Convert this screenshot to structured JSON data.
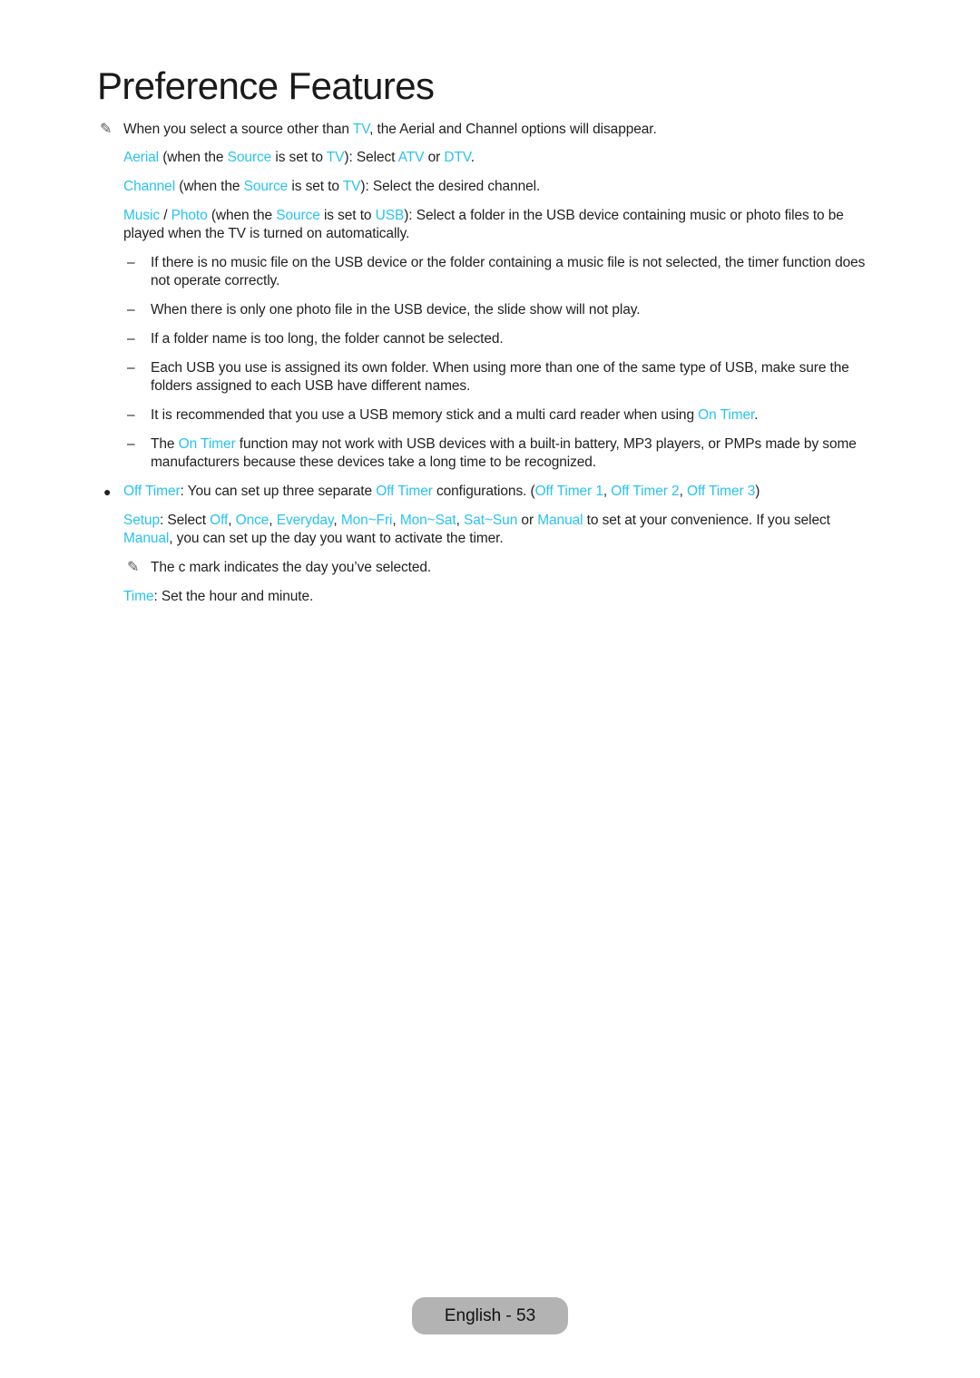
{
  "page": {
    "title": "Preference Features",
    "footer": "English - 53"
  },
  "colors": {
    "highlight": "#29c3f0",
    "text": "#222222",
    "footer_bg": "#b3b3b3"
  },
  "icons": {
    "note": "pencil-note-icon",
    "bullet": "bullet-dot",
    "dash": "en-dash"
  },
  "content": {
    "note1": {
      "a": "When you select a source other than ",
      "b": "TV",
      "c": ", the Aerial and Channel options will disappear."
    },
    "aerial": {
      "a": "Aerial",
      "b": " (when the ",
      "c": "Source",
      "d": " is set to ",
      "e": "TV",
      "f": "): Select ",
      "g": "ATV",
      "h": " or ",
      "i": "DTV",
      "j": "."
    },
    "channel": {
      "a": "Channel",
      "b": " (when the ",
      "c": "Source",
      "d": " is set to ",
      "e": "TV",
      "f": "): Select the desired channel."
    },
    "music": {
      "a": "Music",
      "b": " / ",
      "c": "Photo",
      "d": " (when the ",
      "e": "Source",
      "f": " is set to ",
      "g": "USB",
      "h": "): Select a folder in the USB device containing music or photo files to be played when the TV is turned on automatically."
    },
    "dash_items": [
      "If there is no music file on the USB device or the folder containing a music file is not selected, the timer function does not operate correctly.",
      "When there is only one photo file in the USB device, the slide show will not play.",
      "If a folder name is too long, the folder cannot be selected.",
      "Each USB you use is assigned its own folder. When using more than one of the same type of USB, make sure the folders assigned to each USB have different names."
    ],
    "dash5": {
      "a": "It is recommended that you use a USB memory stick and a multi card reader when using ",
      "b": "On Timer",
      "c": "."
    },
    "dash6": {
      "a": "The ",
      "b": "On Timer",
      "c": " function may not work with USB devices with a built-in battery, MP3 players, or PMPs made by some manufacturers because these devices take a long time to be recognized."
    },
    "offtimer": {
      "a": "Off Timer",
      "b": ": You can set up three separate ",
      "c": "Off Timer",
      "d": " configurations. (",
      "e": "Off Timer 1",
      "f": ", ",
      "g": "Off Timer 2",
      "h": ", ",
      "i": "Off Timer 3",
      "j": ")"
    },
    "setup": {
      "a": "Setup",
      "b": ": Select ",
      "c": "Off",
      "d": ", ",
      "e": "Once",
      "f": ", ",
      "g": "Everyday",
      "h": ", ",
      "i": "Mon~Fri",
      "j": ", ",
      "k": "Mon~Sat",
      "l": ", ",
      "m": "Sat~Sun",
      "n": " or ",
      "o": "Manual",
      "p": " to set at your convenience. If you select ",
      "q": "Manual",
      "r": ", you can set up the day you want to activate the timer."
    },
    "note2": "The c mark indicates the day you’ve selected.",
    "time": {
      "a": "Time",
      "b": ": Set the hour and minute."
    }
  }
}
